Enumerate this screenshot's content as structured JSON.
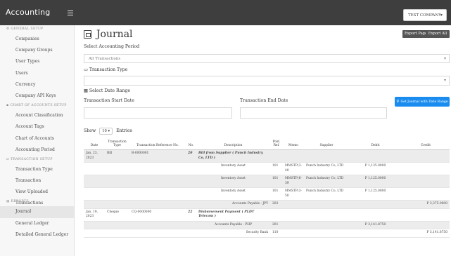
{
  "app": {
    "title": "Accounting",
    "company": "TEST COMPANY"
  },
  "sidebar": {
    "sections": [
      {
        "header": "GENERAL SETUP",
        "items": [
          "Companies",
          "Company Groups",
          "User Types",
          "Users",
          "Currency",
          "Company API Keys"
        ]
      },
      {
        "header": "CHART OF ACCOUNTS SETUP",
        "items": [
          "Account Classification",
          "Account Tags",
          "Chart of Accounts",
          "Accounting Period"
        ]
      },
      {
        "header": "TRANSACTION SETUP",
        "items": [
          "Transaction Type",
          "Transaction",
          "View Uploaded Transactions"
        ]
      },
      {
        "header": "REPORTS",
        "items": [
          "Journal",
          "General Ledger",
          "Detailed General Ledger"
        ]
      }
    ]
  },
  "page": {
    "title": "Journal",
    "export_page": "Export Page",
    "export_all": "Export All",
    "accounting_period_label": "Select Accounting Period",
    "accounting_period_value": "All Transactions",
    "transaction_type_label": "Transaction Type",
    "transaction_type_value": "",
    "date_range_label": "Select Date Range",
    "start_date_label": "Transaction Start Date",
    "end_date_label": "Transaction End Date",
    "get_journal_button": "Get Journal with Date Range",
    "show_label": "Show",
    "entries_value": "10",
    "entries_label": "Entries"
  },
  "table": {
    "headers": [
      "Date",
      "Transaction Type",
      "Transaction Reference No.",
      "No.",
      "Description",
      "Post. Ref.",
      "Memo",
      "Supplier",
      "Debit",
      "Credit"
    ],
    "rows": [
      {
        "group": true,
        "date": "Jan. 23, 2023",
        "type": "Bill",
        "ref": "B-0000001",
        "no": "20",
        "desc": "Bill from Supplier ( Punch Industry Co, LTD )",
        "post": "",
        "memo": "",
        "supplier": "",
        "debit": "",
        "credit": ""
      },
      {
        "group": false,
        "date": "",
        "type": "",
        "ref": "",
        "no": "",
        "desc": "Inventory Asset",
        "post": "101",
        "memo": "MMSTP(3-40",
        "supplier": "Punch Industry Co, LTD",
        "debit": "P 1,125.0000",
        "credit": ""
      },
      {
        "group": true,
        "date": "",
        "type": "",
        "ref": "",
        "no": "",
        "desc": "Inventory Asset",
        "post": "101",
        "memo": "MMSTP(6-39",
        "supplier": "Punch Industry Co, LTD",
        "debit": "P 1,125.0000",
        "credit": ""
      },
      {
        "group": false,
        "date": "",
        "type": "",
        "ref": "",
        "no": "",
        "desc": "Inventory Asset",
        "post": "101",
        "memo": "MMSTP(3-50",
        "supplier": "Punch Industry Co, LTD",
        "debit": "P 1,125.0000",
        "credit": ""
      },
      {
        "group": true,
        "date": "",
        "type": "",
        "ref": "",
        "no": "",
        "desc": "Accounts Payable - JPY",
        "post": "202",
        "memo": "",
        "supplier": "",
        "debit": "",
        "credit": "P 3,375.0000"
      },
      {
        "group": false,
        "date": "Jan. 19, 2023",
        "type": "Cheque",
        "ref": "CQ-0000000",
        "no": "22",
        "desc": "Disbursement Payment ( PLDT Telecom )",
        "post": "",
        "memo": "",
        "supplier": "",
        "debit": "",
        "credit": ""
      },
      {
        "group": true,
        "date": "",
        "type": "",
        "ref": "",
        "no": "",
        "desc": "Accounts Payable - PHP",
        "post": "201",
        "memo": "",
        "supplier": "",
        "debit": "P 3,141.8750",
        "credit": ""
      },
      {
        "group": false,
        "date": "",
        "type": "",
        "ref": "",
        "no": "",
        "desc": "Security Bank",
        "post": "110",
        "memo": "",
        "supplier": "",
        "debit": "",
        "credit": "P 3,141.8750"
      }
    ]
  },
  "colors": {
    "topbar": "#3e3e3e",
    "accent": "#1a8cf0",
    "row_alt": "#ececec"
  },
  "icons": [
    "menu-icon",
    "caret-down-icon",
    "journal-icon",
    "tag-icon",
    "calendar-icon",
    "search-icon"
  ]
}
